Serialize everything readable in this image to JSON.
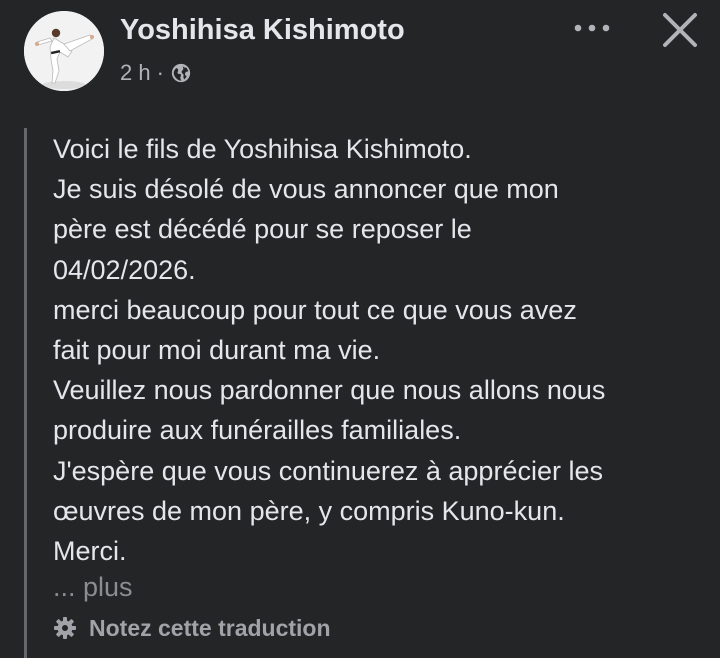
{
  "post": {
    "author": "Yoshihisa Kishimoto",
    "time": "2 h",
    "separator": "·",
    "visibility_icon": "globe-icon",
    "body": "Voici le fils de Yoshihisa Kishimoto.\nJe suis désolé de vous annoncer que mon\npère est décédé pour se reposer le\n04/02/2026.\nmerci beaucoup pour tout ce que vous avez\nfait pour moi durant ma vie.\nVeuillez nous pardonner que nous allons nous\nproduire aux funérailles familiales.\nJ'espère que vous continuerez à apprécier les\nœuvres de mon père, y compris Kuno-kun.\nMerci.",
    "see_more": "... plus",
    "translation_rating": "Notez cette traduction"
  },
  "header": {
    "more_icon": "more-options-icon",
    "close_icon": "close-icon"
  },
  "colors": {
    "background": "#242526",
    "primary_text": "#e4e6eb",
    "secondary_text": "#b0b3b8",
    "muted_text": "#8a8d91"
  }
}
